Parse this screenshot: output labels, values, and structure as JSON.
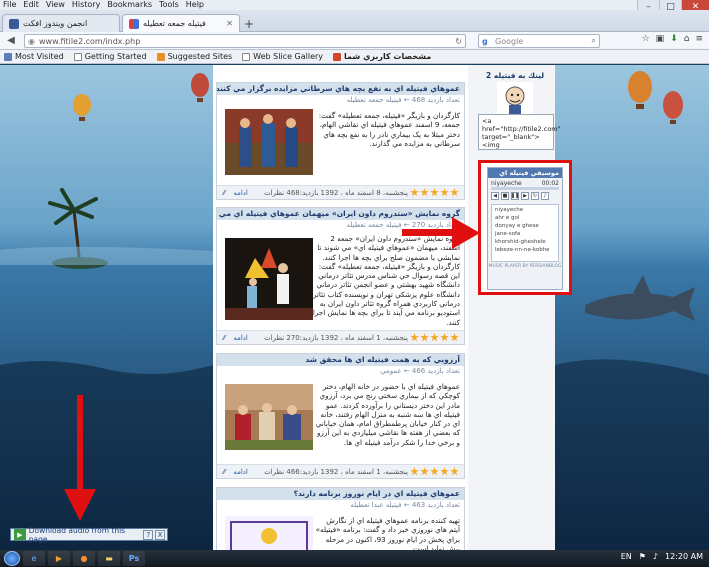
{
  "menubar": {
    "items": [
      "File",
      "Edit",
      "View",
      "History",
      "Bookmarks",
      "Tools",
      "Help"
    ]
  },
  "tabs": [
    {
      "label": "انجمن ويندوز افكت",
      "active": false
    },
    {
      "label": "فيتيله جمعه تعطيله",
      "active": true
    }
  ],
  "address": {
    "url": "www.fitile2.com/indx.php"
  },
  "search": {
    "placeholder": "Google"
  },
  "bookmarks": [
    "Most Visited",
    "Getting Started",
    "Suggested Sites",
    "Web Slice Gallery",
    "مشخصات كاربري شما"
  ],
  "posts": [
    {
      "title": "عموهاي فيتيله اي به نفع بچه هاي سرطاني مزايده برگزار مي كنند",
      "author": "فيتيله جمعه تعطيله",
      "views_label": "تعداد بازديد",
      "views": "468",
      "text": "كارگردان و بازيگر «فيتيله، جمعه تعطيله» گفت: جمعه، 9 اسفند عموهاي فيتيله اي نقاشي الهام، دختر مبتلا به يک بيماري نادر را به نفع بچه هاي سرطاني به مزايده مي گذارند.",
      "date": "پنجشنبه، 8 اسفند ماه ، 1392 بازديد:468 نظرات",
      "more": "ادامه"
    },
    {
      "title": "گروه نمايش «ستدروم داون ايران» ميهمان عموهاي فيتيله اي مي شوند",
      "author": "فيتيله جمعه تعطيله",
      "views_label": "تعداد بازديد",
      "views": "270",
      "text": "گروه نمايش «ستدروم داون ايران» جمعه 2 اسفند، ميهمان «عموهاي فيتيله اي» مي شوند تا نمايشي با مضمون صلح براي بچه ها اجرا كنند. كارگردان و بازيگر «فيتيله، جمعه تعطيله» گفت: اين قصه رسوال حي شناس مدرس تئاتر درماني دانشگاه شهيد بهشتي و عضو انجمن تئاتر درماني دانشگاه علوم پزشكي تهران و نويسنده كتاب تئاتر درماني كاربردي همراه گروه تئاتر داون ايران به استوديو برنامه مي آيند تا براي بچه ها نمايش اجرا كنند.",
      "date": "پنجشنبه، 1 اسفند ماه ، 1392 بازديد:270 نظرات",
      "more": "ادامه"
    },
    {
      "title": "آرزويي كه به همت فيتيله اي ها محقق شد",
      "author": "عمومي",
      "views_label": "تعداد بازديد",
      "views": "466",
      "text": "عموهاي فيتيله اي با حضور در خانه الهام، دختر كوچكي كه از بيماري سختي رنج مي برد، آرزوي مادر اين دختر ديستاني را برآورده كردند. عمو فيتيله اي ها سه شنبه به منزل الهام رفتند، خانه اي در كنار خيابان پرطمطراق امام، همان خياباني كه بعضي از هفته ها نقاشي ميلياردي به اين آرزو و برخي خدا را شكر درآمد فيتيله اي ها.",
      "date": "پنجشنبه، 1 اسفند ماه ، 1392 بازديد:466 نظرات",
      "more": "ادامه"
    },
    {
      "title": "عموهاي فيتيله اي در ايام نوروز برنامه دارند؟",
      "author": "فيتيله عيدا تعطيله",
      "views_label": "تعداد بازديد",
      "views": "463",
      "text": "تهيه كننده برنامه عموهاي فيتيله اي از نگارش آيتم هاي نوروزي خبر داد و گفت: برنامه «فيتيله» براي پخش در ايام نوروز 93، اكنون در مرحله پيش توليد است."
    }
  ],
  "sidebar": {
    "title": "لينك به فيتيله 2",
    "code": "<a href=\"http://fitile2.com\" target=\"_blank\"><img",
    "player_title": "موسيقي فيتيله اي",
    "track": "niyayeche",
    "time": "00:02",
    "playlist": [
      "niyayeche",
      "ahr e gol",
      "donyay e ghese",
      "jane-sofa",
      "khorshid-gheshele",
      "lebeze-nn-ne-kobhe"
    ],
    "player_footer": "MUSIC PLAYER BY PERSIANBLOG"
  },
  "download_bar": {
    "label": "Download audio from this page",
    "help": "?",
    "close": "X"
  },
  "taskbar": {
    "lang": "EN",
    "time": "12:20 AM"
  }
}
